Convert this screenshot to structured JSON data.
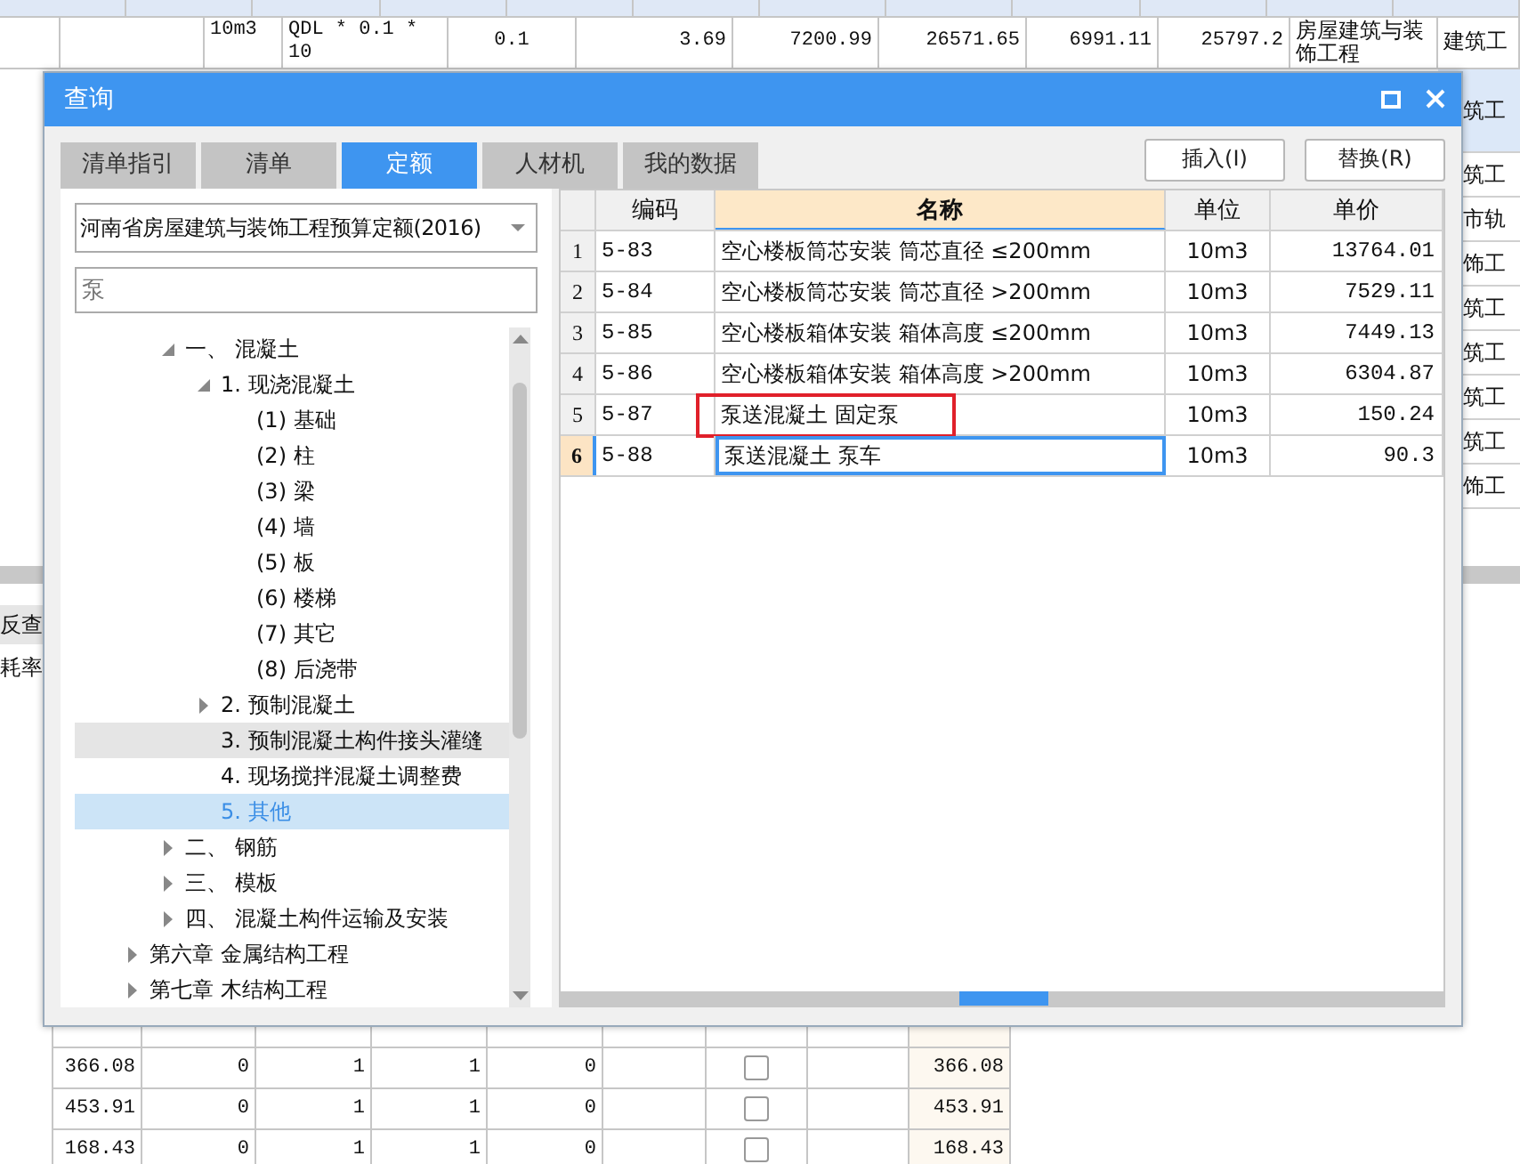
{
  "background_sheet": {
    "top_row": [
      "10m3",
      "QDL * 0.1 * 10",
      "0.1",
      "3.69",
      "7200.99",
      "26571.65",
      "6991.11",
      "25797.2",
      "房屋建筑与装饰工程",
      "建筑工"
    ],
    "right_column": [
      "筑工",
      "筑工",
      "市轨",
      "饰工",
      "筑工",
      "筑工",
      "筑工",
      "筑工",
      "饰工"
    ],
    "side_labels": [
      "反查",
      "耗率"
    ],
    "bottom_rows": [
      {
        "cells": [
          "366.08",
          "0",
          "1",
          "1",
          "0"
        ],
        "checked": false,
        "total": "366.08"
      },
      {
        "cells": [
          "453.91",
          "0",
          "1",
          "1",
          "0"
        ],
        "checked": false,
        "total": "453.91"
      },
      {
        "cells": [
          "168.43",
          "0",
          "1",
          "1",
          "0"
        ],
        "checked": false,
        "total": "168.43"
      }
    ]
  },
  "dialog": {
    "title": "查询",
    "tabs": [
      {
        "label": "清单指引",
        "selected": false
      },
      {
        "label": "清单",
        "selected": false
      },
      {
        "label": "定额",
        "selected": true
      },
      {
        "label": "人材机",
        "selected": false
      },
      {
        "label": "我的数据",
        "selected": false
      }
    ],
    "buttons": [
      "插入(I)",
      "替换(R)"
    ],
    "standard_dropdown": {
      "value": "河南省房屋建筑与装饰工程预算定额(2016)"
    },
    "search": {
      "value": "泵"
    },
    "tree": [
      {
        "children": [
          {
            "label": "一、  混凝土",
            "expanded": true,
            "children": [
              {
                "label": "1. 现浇混凝土",
                "expanded": true,
                "children": [
                  {
                    "label": "(1) 基础"
                  },
                  {
                    "label": "(2) 柱"
                  },
                  {
                    "label": "(3) 梁"
                  },
                  {
                    "label": "(4) 墙"
                  },
                  {
                    "label": "(5) 板"
                  },
                  {
                    "label": "(6) 楼梯"
                  },
                  {
                    "label": "(7) 其它"
                  },
                  {
                    "label": "(8) 后浇带"
                  }
                ]
              },
              {
                "label": "2. 预制混凝土",
                "expanded": false
              },
              {
                "label": "3. 预制混凝土构件接头灌缝",
                "hovered": true,
                "selected": false
              },
              {
                "label": "4. 现场搅拌混凝土调整费",
                "selected": false
              },
              {
                "label": "5. 其他",
                "selected": true
              }
            ]
          },
          {
            "label": "二、  钢筋",
            "expanded": false
          },
          {
            "label": "三、  模板",
            "expanded": false
          },
          {
            "label": "四、  混凝土构件运输及安装",
            "expanded": false
          }
        ]
      },
      {
        "label": "第六章 金属结构工程",
        "expanded": false
      },
      {
        "label": "第七章 木结构工程",
        "expanded": false
      }
    ],
    "table": {
      "columns": [
        {
          "label": "编码",
          "selected": false
        },
        {
          "label": "名称",
          "selected": true
        },
        {
          "label": "单位",
          "selected": false
        },
        {
          "label": "单价",
          "selected": false
        }
      ],
      "rows": [
        {
          "num": "1",
          "code": "5-83",
          "name": "空心楼板筒芯安装 筒芯直径 ≤200mm",
          "unit": "10m3",
          "price": "13764.01",
          "selected": false,
          "marked": false
        },
        {
          "num": "2",
          "code": "5-84",
          "name": "空心楼板筒芯安装 筒芯直径 >200mm",
          "unit": "10m3",
          "price": "7529.11",
          "selected": false,
          "marked": false
        },
        {
          "num": "3",
          "code": "5-85",
          "name": "空心楼板箱体安装 箱体高度 ≤200mm",
          "unit": "10m3",
          "price": "7449.13",
          "selected": false,
          "marked": false
        },
        {
          "num": "4",
          "code": "5-86",
          "name": "空心楼板箱体安装 箱体高度 >200mm",
          "unit": "10m3",
          "price": "6304.87",
          "selected": false,
          "marked": false
        },
        {
          "num": "5",
          "code": "5-87",
          "name": "泵送混凝土 固定泵",
          "unit": "10m3",
          "price": "150.24",
          "selected": false,
          "marked": true
        },
        {
          "num": "6",
          "code": "5-88",
          "name": "泵送混凝土 泵车",
          "unit": "10m3",
          "price": "90.3",
          "selected": true,
          "marked": false
        }
      ]
    }
  }
}
